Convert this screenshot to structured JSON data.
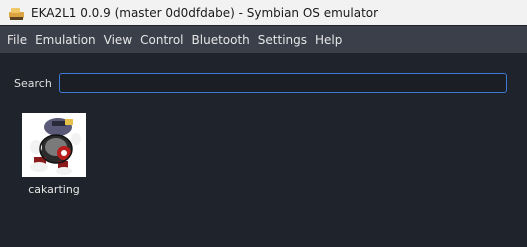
{
  "window": {
    "title": "EKA2L1 0.0.9 (master 0d0dfdabe) - Symbian OS emulator",
    "icon": "eka2l1-app-icon"
  },
  "menu": {
    "items": [
      {
        "label": "File"
      },
      {
        "label": "Emulation"
      },
      {
        "label": "View"
      },
      {
        "label": "Control"
      },
      {
        "label": "Bluetooth"
      },
      {
        "label": "Settings"
      },
      {
        "label": "Help"
      }
    ]
  },
  "search": {
    "label": "Search",
    "value": "",
    "placeholder": ""
  },
  "apps": [
    {
      "name": "cakarting",
      "icon": "cakarting-app-icon"
    }
  ],
  "colors": {
    "background": "#1f232b",
    "menubar": "#3a3f4a",
    "titlebar": "#f2f2f2",
    "focus_border": "#3d7ad6"
  }
}
